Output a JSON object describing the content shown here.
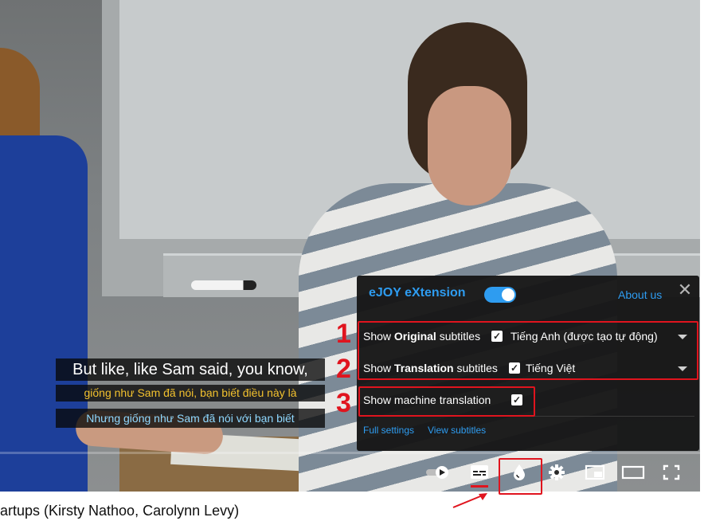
{
  "subtitles": {
    "original": "But like, like Sam said, you know,",
    "translation_1": "giống như Sam đã nói, bạn biết điều này là",
    "translation_2": "Nhưng giống như Sam đã nói với bạn biết"
  },
  "panel": {
    "title": "eJOY eXtension",
    "toggle_on": true,
    "about_label": "About us",
    "close_glyph": "✕",
    "rows": [
      {
        "prefix": "Show ",
        "bold": "Original",
        "suffix": " subtitles",
        "checked": true,
        "value": "Tiếng Anh (được tạo tự động)"
      },
      {
        "prefix": "Show ",
        "bold": "Translation",
        "suffix": " subtitles",
        "checked": true,
        "value": "Tiếng Việt"
      },
      {
        "label": "Show machine translation",
        "checked": true
      }
    ],
    "check_glyph": "✓",
    "full_settings_label": "Full settings",
    "view_subtitles_label": "View subtitles"
  },
  "annotations": {
    "n1": "1",
    "n2": "2",
    "n3": "3"
  },
  "controls": {
    "icons": [
      "autoplay-toggle-icon",
      "subtitles-icon",
      "ejoy-drop-icon",
      "settings-gear-icon",
      "miniplayer-icon",
      "theater-mode-icon",
      "fullscreen-icon"
    ]
  },
  "colors": {
    "accent": "#2e9cf0",
    "annotation_red": "#e0141e",
    "subtitle_yellow": "#f2c12e",
    "subtitle_blue": "#8fd8ff"
  },
  "video_title": "artups (Kirsty Nathoo, Carolynn Levy)"
}
